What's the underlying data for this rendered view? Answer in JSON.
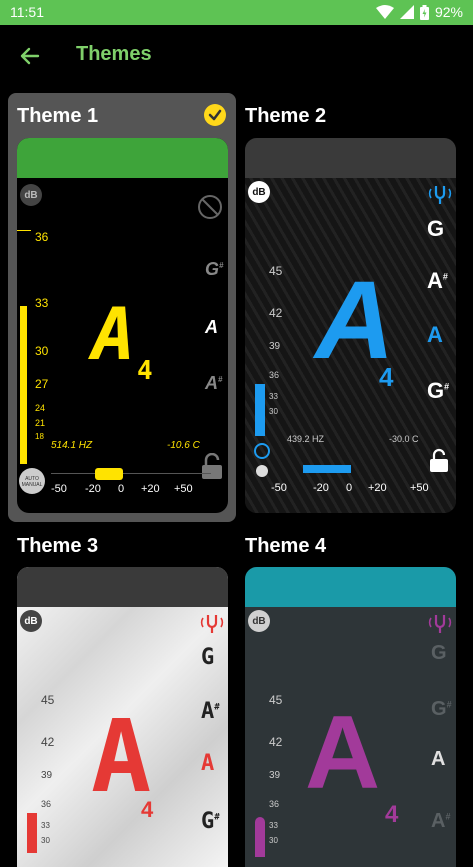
{
  "status_bar": {
    "time": "11:51",
    "battery": "92%"
  },
  "app_bar": {
    "title": "Themes",
    "back_icon": "arrow-left-icon"
  },
  "themes": [
    {
      "label": "Theme 1",
      "selected": true,
      "note": "A",
      "octave": "4",
      "side_notes": [
        [
          "G",
          "#"
        ],
        [
          "A",
          ""
        ],
        [
          "A",
          "#"
        ]
      ],
      "db": "dB",
      "scale_left": [
        "36",
        "33",
        "30",
        "27",
        "24",
        "21",
        "18"
      ],
      "freq": "514.1 HZ",
      "temp": "-10.6 C",
      "ticks": [
        "-50",
        "-20",
        "0",
        "+20",
        "+50"
      ],
      "auto_manual": "AUTO MANUAL",
      "accent": "#ffe300",
      "header_color": "#3ea43a"
    },
    {
      "label": "Theme 2",
      "note": "A",
      "octave": "4",
      "side_notes": [
        [
          "G",
          ""
        ],
        [
          "A",
          "#"
        ],
        [
          "A",
          ""
        ],
        [
          "G",
          "#"
        ]
      ],
      "db": "dB",
      "scale_left": [
        "45",
        "42",
        "39",
        "36",
        "33",
        "30"
      ],
      "freq": "439.2 HZ",
      "temp": "-30.0 C",
      "ticks": [
        "-50",
        "-20",
        "0",
        "+20",
        "+50"
      ],
      "accent": "#1d9bf0",
      "header_color": "#3a3a3a"
    },
    {
      "label": "Theme 3",
      "note": "A",
      "octave": "4",
      "side_notes": [
        [
          "G",
          ""
        ],
        [
          "A",
          "#"
        ],
        [
          "A",
          ""
        ],
        [
          "G",
          "#"
        ]
      ],
      "db": "dB",
      "scale_left": [
        "45",
        "42",
        "39",
        "36",
        "33",
        "30"
      ],
      "accent": "#e53935",
      "header_color": "#3a3a3a"
    },
    {
      "label": "Theme 4",
      "note": "A",
      "octave": "4",
      "side_notes": [
        [
          "G",
          ""
        ],
        [
          "G",
          "#"
        ],
        [
          "A",
          ""
        ],
        [
          "A",
          "#"
        ]
      ],
      "db": "dB",
      "scale_left": [
        "45",
        "42",
        "39",
        "36",
        "33",
        "30"
      ],
      "accent": "#a23a9a",
      "header_color": "#1a9aa8"
    }
  ]
}
